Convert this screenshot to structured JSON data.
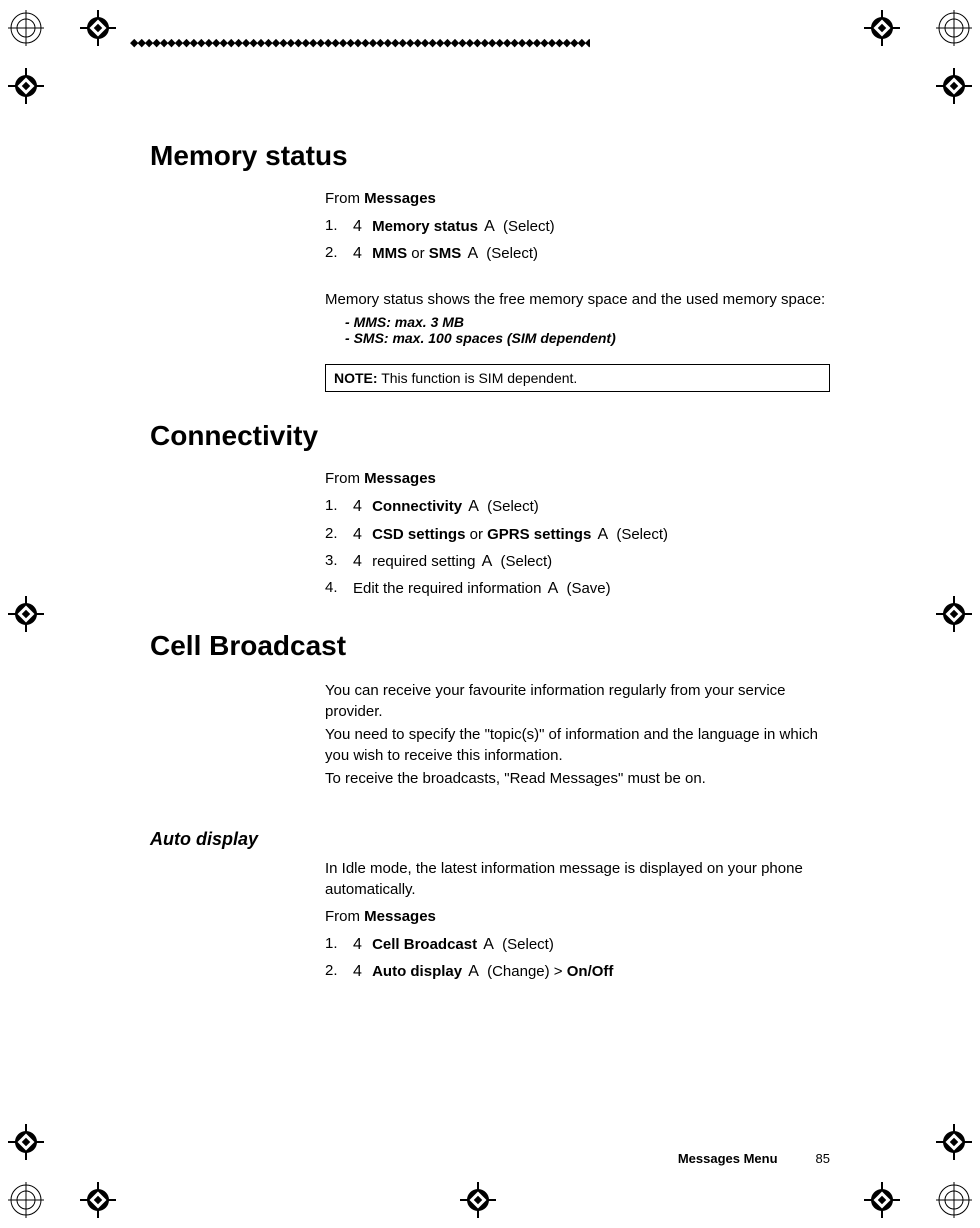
{
  "sections": {
    "memory_status": {
      "heading": "Memory status",
      "from_prefix": "From ",
      "from_target": "Messages",
      "steps": [
        {
          "sym4": "4",
          "bold1": "Memory status",
          "symA": "A",
          "paren": "(Select)"
        },
        {
          "sym4": "4",
          "bold1": "MMS",
          "mid": " or ",
          "bold2": "SMS",
          "symA": "A",
          "paren": "(Select)"
        }
      ],
      "description": "Memory status shows the free memory space and the used memory space:",
      "bullets": [
        "MMS: max. 3 MB",
        "SMS: max. 100 spaces (SIM dependent)"
      ],
      "note_label": "NOTE:",
      "note_text": " This function is SIM dependent."
    },
    "connectivity": {
      "heading": "Connectivity",
      "from_prefix": "From ",
      "from_target": "Messages",
      "steps": [
        {
          "sym4": "4",
          "bold1": "Connectivity",
          "symA": "A",
          "paren": "(Select)"
        },
        {
          "sym4": "4",
          "bold1": "CSD settings",
          "mid": " or ",
          "bold2": "GPRS settings",
          "symA": "A",
          "paren": "(Select)"
        },
        {
          "sym4": "4",
          "plain": " required setting ",
          "symA": "A",
          "paren": "(Select)"
        },
        {
          "plain_full": "Edit the required information ",
          "symA": "A",
          "paren": "(Save)"
        }
      ]
    },
    "cell_broadcast": {
      "heading": "Cell Broadcast",
      "para1": "You can receive your favourite information regularly from your service provider.",
      "para2": "You need to specify the \"topic(s)\" of information and the language in which you wish to receive this information.",
      "para3": "To receive the broadcasts, \"Read Messages\" must be on.",
      "auto_display": {
        "subheading": "Auto display",
        "intro": "In Idle mode, the latest information message is displayed on your phone automatically.",
        "from_prefix": "From ",
        "from_target": "Messages",
        "steps": [
          {
            "sym4": "4",
            "bold1": "Cell Broadcast",
            "symA": "A",
            "paren": "(Select)"
          },
          {
            "sym4": "4",
            "bold1": "Auto display",
            "symA": "A",
            "paren": "(Change) > ",
            "bold_tail": "On/Off"
          }
        ]
      }
    }
  },
  "footer": {
    "section": "Messages Menu",
    "page": "85"
  },
  "decoration": {
    "diamonds": "◆◆◆◆◆◆◆◆◆◆◆◆◆◆◆◆◆◆◆◆◆◆◆◆◆◆◆◆◆◆◆◆◆◆◆◆◆◆◆◆◆◆◆◆◆◆◆◆◆◆◆◆◆◆◆◆◆◆◆◆◆◆◆◆◆◆◆◆◆◆◆◆◆◆◆◆◆◆◆◆"
  }
}
